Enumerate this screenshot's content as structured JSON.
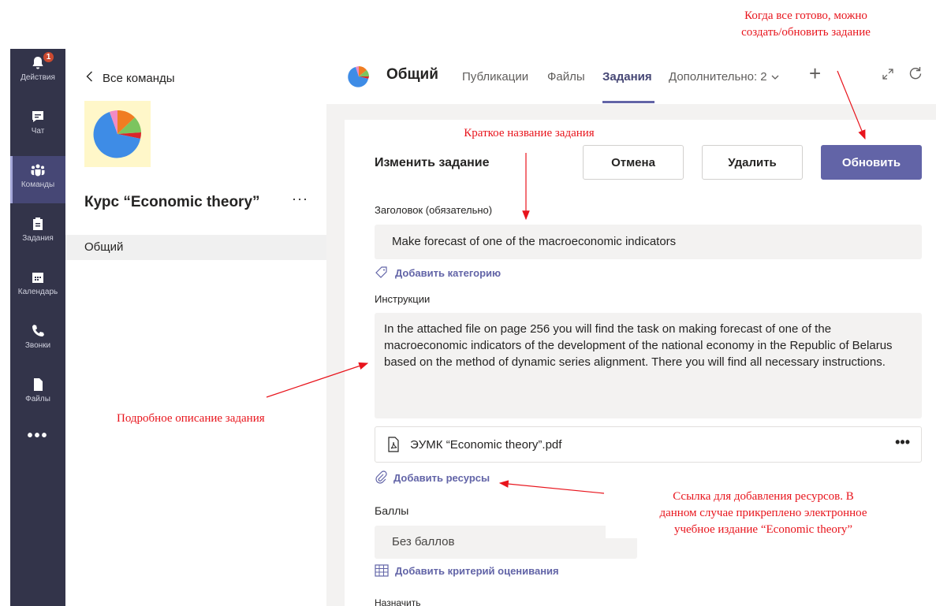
{
  "rail": {
    "items": [
      {
        "label": "Действия",
        "icon": "bell-icon",
        "badge": "1"
      },
      {
        "label": "Чат",
        "icon": "chat-icon"
      },
      {
        "label": "Команды",
        "icon": "teams-icon",
        "active": true
      },
      {
        "label": "Задания",
        "icon": "assignments-icon"
      },
      {
        "label": "Календарь",
        "icon": "calendar-icon"
      },
      {
        "label": "Звонки",
        "icon": "phone-icon"
      },
      {
        "label": "Файлы",
        "icon": "files-icon"
      }
    ],
    "more": "•••"
  },
  "team_panel": {
    "back_label": "Все команды",
    "team_name": "Курс “Economic theory”",
    "more": "···",
    "channel": "Общий"
  },
  "header": {
    "channel_title": "Общий",
    "tabs": [
      {
        "label": "Публикации"
      },
      {
        "label": "Файлы"
      },
      {
        "label": "Задания",
        "active": true
      },
      {
        "label": "Дополнительно: 2"
      }
    ],
    "plus": "+"
  },
  "form": {
    "title": "Изменить задание",
    "cancel_label": "Отмена",
    "delete_label": "Удалить",
    "update_label": "Обновить",
    "heading_label": "Заголовок (обязательно)",
    "heading_value": "Make forecast of one of the macroeconomic indicators",
    "add_category": "Добавить категорию",
    "instructions_label": "Инструкции",
    "instructions_value": "In the attached file on page 256 you will find the task on making forecast of one of the macroeconomic indicators of the development of the national economy in the Republic of Belarus based on the method of dynamic series alignment. There you will find all necessary instructions.",
    "attachment_name": "ЭУМК “Economic theory”.pdf",
    "attachment_more": "•••",
    "add_resources": "Добавить ресурсы",
    "points_label": "Баллы",
    "points_value": "Без баллов",
    "add_rubric": "Добавить критерий оценивания",
    "assign_label": "Назначить"
  },
  "annotations": {
    "ready": "Когда все готово, можно\nсоздать/обновить задание",
    "short_title": "Краткое название задания",
    "description": "Подробное описание задания",
    "resources": "Ссылка для добавления ресурсов. В\nданном случае прикреплено электронное\nучебное издание “Economic theory”"
  },
  "colors": {
    "rail": "#33344a",
    "accent": "#6264a7",
    "annotation": "#e8141c",
    "badge": "#cc4a31"
  }
}
